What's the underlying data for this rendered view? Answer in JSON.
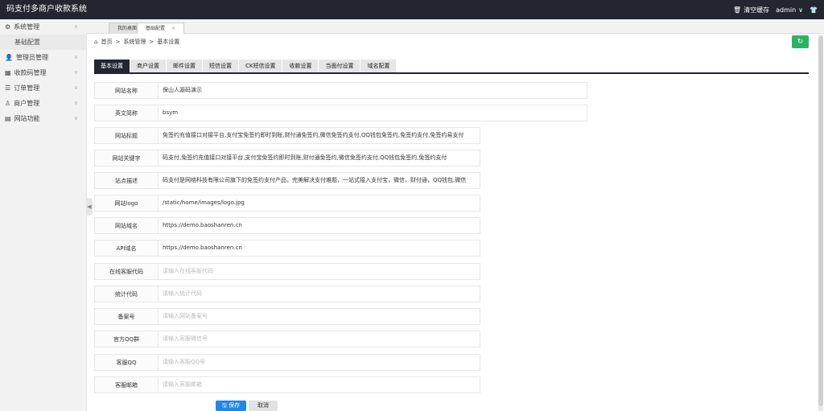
{
  "app": {
    "title": "码支付多商户收款系统"
  },
  "topbar": {
    "clear_cache": "清空缓存",
    "user": "admin"
  },
  "sidebar": {
    "items": [
      {
        "label": "系统管理",
        "icon": "gear-icon",
        "expanded": true,
        "children": [
          "基础配置"
        ]
      },
      {
        "label": "管理员管理",
        "icon": "user-icon"
      },
      {
        "label": "收款码管理",
        "icon": "qrcode-icon"
      },
      {
        "label": "订单管理",
        "icon": "list-icon"
      },
      {
        "label": "商户管理",
        "icon": "merchant-icon"
      },
      {
        "label": "网站功能",
        "icon": "site-icon"
      }
    ]
  },
  "tabs": [
    {
      "label": "我的桌面"
    },
    {
      "label": "基础配置",
      "active": true,
      "close": "×"
    }
  ],
  "breadcrumb": {
    "home": "首页",
    "sep": ">",
    "level1": "系统管理",
    "level2": "基本设置"
  },
  "settings_tabs": [
    "基本设置",
    "商户设置",
    "邮件设置",
    "短信设置",
    "CK短信设置",
    "收款设置",
    "当面付设置",
    "域名配置"
  ],
  "form": [
    {
      "label": "网站名称",
      "value": "保山人源码演示"
    },
    {
      "label": "英文简称",
      "value": "bsym"
    },
    {
      "label": "网站标题",
      "value": "免签约充值接口对接平台,支付宝免签约即时到账,财付通免签约,微信免签约支付,QQ钱包免签约,免签约支付,免签约易支付"
    },
    {
      "label": "网站关键字",
      "value": "码支付,免签约充值接口对接平台,支付宝免签约即时到账,财付通免签约,微信免签约支付,QQ钱包免签约,免签约支付"
    },
    {
      "label": "站点描述",
      "value": "码支付是网络科技有限公司旗下的免签约支付产品，完美解决支付难题，一站式接入支付宝，微信，财付通，QQ钱包,微信"
    },
    {
      "label": "网站logo",
      "value": "/static/home/images/logo.jpg"
    },
    {
      "label": "网站域名",
      "value": "https://demo.baoshanren.cn"
    },
    {
      "label": "API域名",
      "value": "https://demo.baoshanren.cn"
    },
    {
      "label": "在线客服代码",
      "placeholder": "请输入在线客服代码"
    },
    {
      "label": "统计代码",
      "placeholder": "请输入统计代码"
    },
    {
      "label": "备案号",
      "placeholder": "请输入网站备案号"
    },
    {
      "label": "官方QQ群",
      "placeholder": "请输入客服微信号"
    },
    {
      "label": "客服QQ",
      "placeholder": "请输入客服QQ号"
    },
    {
      "label": "客服邮箱",
      "placeholder": "请输入客服邮箱"
    }
  ],
  "buttons": {
    "save": "保存",
    "cancel": "取消"
  },
  "colors": {
    "topbar": "#23262e",
    "refresh": "#28b463",
    "save": "#1e88e5"
  }
}
